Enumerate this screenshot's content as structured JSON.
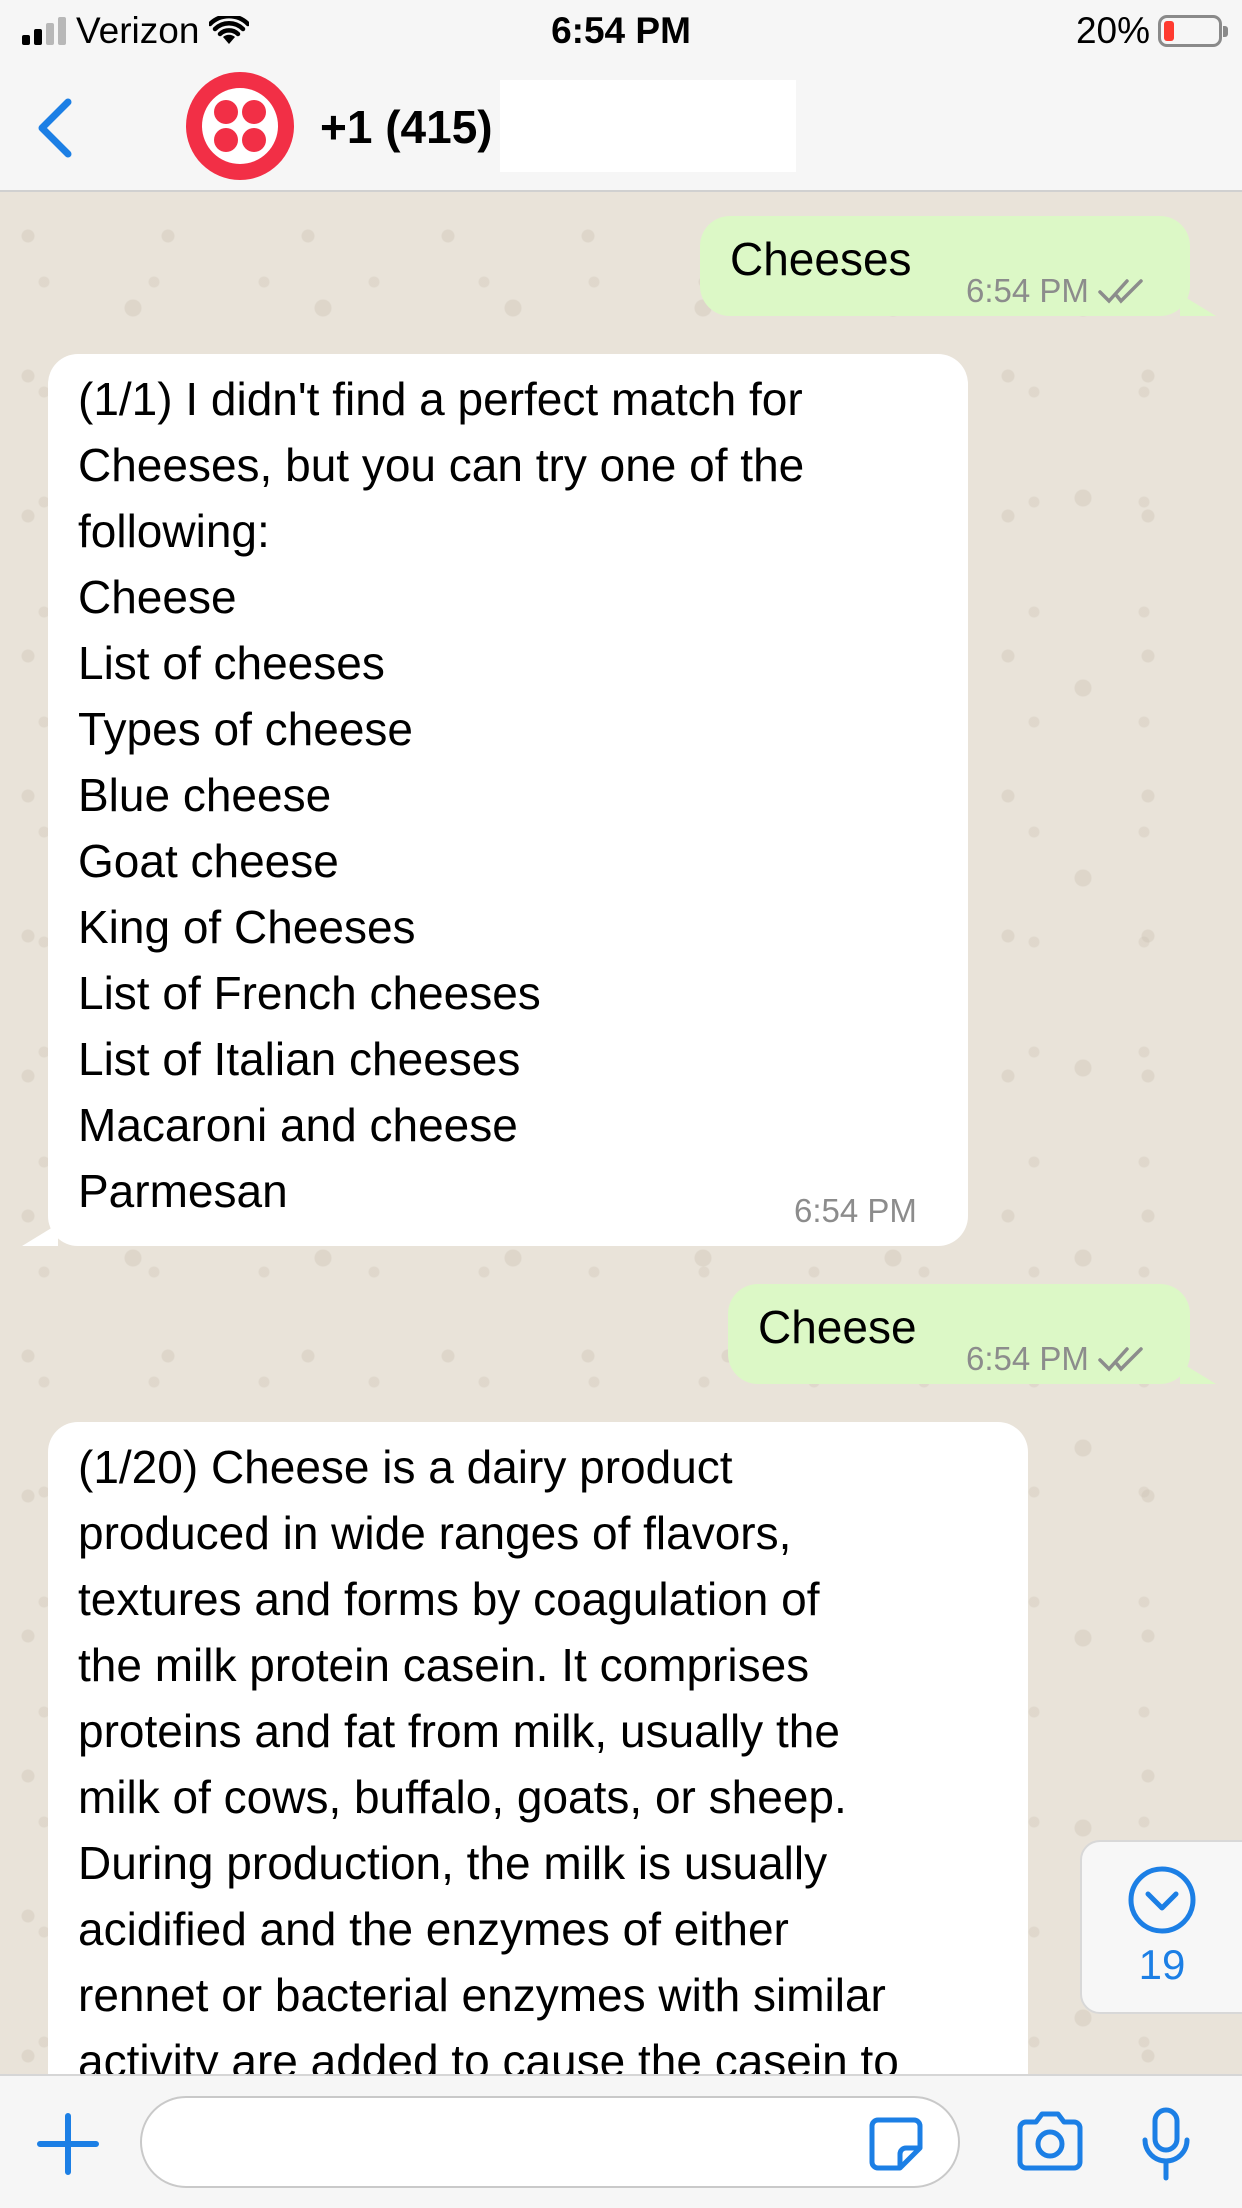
{
  "status_bar": {
    "carrier": "Verizon",
    "time": "6:54 PM",
    "battery_percent": "20%",
    "battery_level": 0.2
  },
  "header": {
    "contact_name": "+1 (415)",
    "back_icon": "chevron-left-icon"
  },
  "messages": [
    {
      "direction": "outgoing",
      "text": "Cheeses",
      "time": "6:54 PM",
      "status_icon": "double-check-icon"
    },
    {
      "direction": "incoming",
      "lines": [
        "(1/1) I didn't find a perfect match for",
        "Cheeses, but you can try one of the",
        "following:",
        "Cheese",
        "List of cheeses",
        "Types of cheese",
        "Blue cheese",
        "Goat cheese",
        "King of Cheeses",
        "List of French cheeses",
        "List of Italian cheeses",
        "Macaroni and cheese",
        "Parmesan"
      ],
      "time": "6:54 PM"
    },
    {
      "direction": "outgoing",
      "text": "Cheese",
      "time": "6:54 PM",
      "status_icon": "double-check-icon"
    },
    {
      "direction": "incoming",
      "lines": [
        "(1/20) Cheese is a dairy product",
        "produced in wide ranges of flavors,",
        "textures and forms by coagulation of",
        "the milk protein casein. It comprises",
        "proteins and fat from milk, usually the",
        "milk of cows, buffalo, goats, or sheep.",
        "During production, the milk is usually",
        "acidified and the enzymes of either",
        "rennet or bacterial enzymes with similar",
        "activity are added to cause the casein to"
      ]
    }
  ],
  "scroll_down": {
    "unread_count": "19",
    "icon": "chevron-down-circle-icon"
  },
  "composer": {
    "placeholder": "",
    "value": ""
  },
  "colors": {
    "outgoing_bubble": "#dcf8c6",
    "incoming_bubble": "#ffffff",
    "accent": "#1c7fe5",
    "avatar": "#f22f46",
    "battery_low": "#ff3b30"
  }
}
